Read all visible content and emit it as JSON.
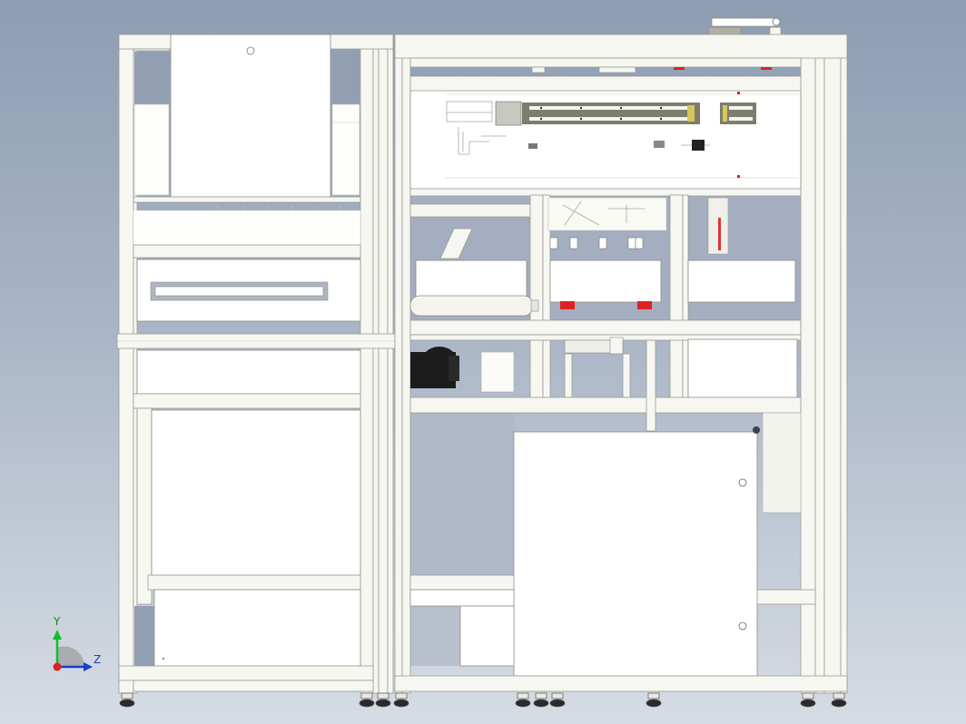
{
  "viewport": {
    "background_top": "#8e9db3",
    "background_bottom": "#d6dce4",
    "frame_color": "#f7f7f2",
    "accent_red": "#dd2222"
  },
  "triad": {
    "y_label": "Y",
    "z_label": "Z",
    "y_color": "#0a8a1a",
    "z_color": "#1c3cc8",
    "origin_color": "#e02020"
  }
}
